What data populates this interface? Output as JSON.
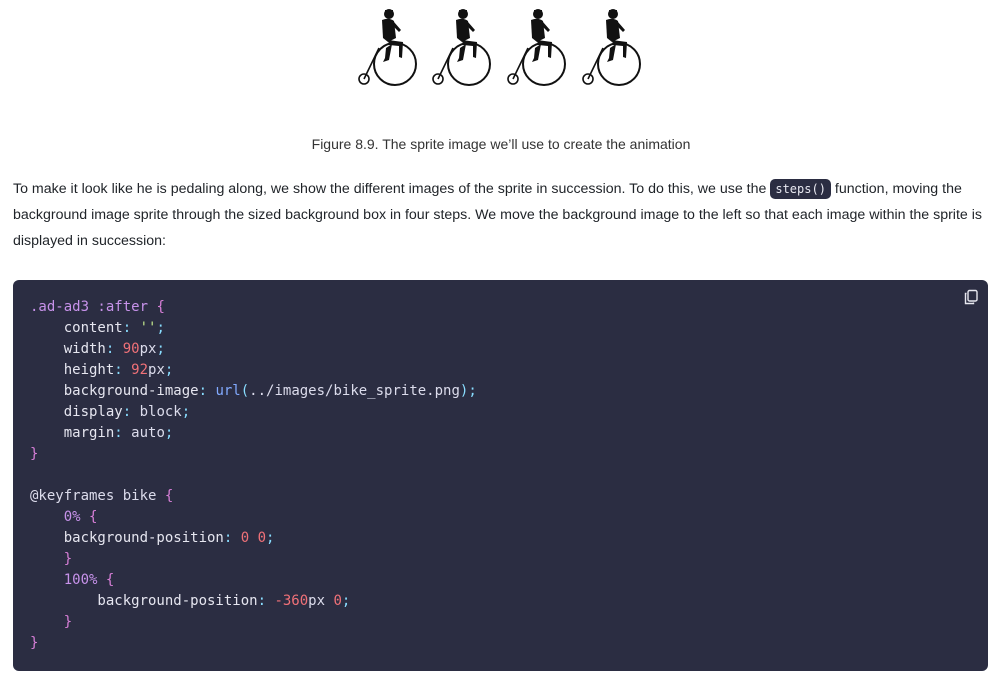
{
  "figure": {
    "caption": "Figure 8.9. The sprite image we’ll use to create the animation",
    "image_description_icon": "penny-farthing-rider-sprite"
  },
  "paragraph": {
    "before": "To make it look like he is pedaling along, we show the different images of the sprite in succession. To do this, we use the ",
    "code": "steps()",
    "after": " function, moving the background image sprite through the sized background box in four steps. We move the background image to the left so that each image within the sprite is displayed in succession:"
  },
  "code_block": {
    "copy_icon": "copy-icon",
    "lines": [
      [
        {
          "t": ".ad-ad3 :after ",
          "c": "k"
        },
        {
          "t": "{",
          "c": "br"
        }
      ],
      [
        {
          "t": "    content",
          "c": "p"
        },
        {
          "t": ":",
          "c": "o"
        },
        {
          "t": " ''",
          "c": "s"
        },
        {
          "t": ";",
          "c": "o"
        }
      ],
      [
        {
          "t": "    width",
          "c": "p"
        },
        {
          "t": ":",
          "c": "o"
        },
        {
          "t": " 90",
          "c": "v"
        },
        {
          "t": "px",
          "c": "u"
        },
        {
          "t": ";",
          "c": "o"
        }
      ],
      [
        {
          "t": "    height",
          "c": "p"
        },
        {
          "t": ":",
          "c": "o"
        },
        {
          "t": " 92",
          "c": "v"
        },
        {
          "t": "px",
          "c": "u"
        },
        {
          "t": ";",
          "c": "o"
        }
      ],
      [
        {
          "t": "    background-image",
          "c": "p"
        },
        {
          "t": ":",
          "c": "o"
        },
        {
          "t": " url",
          "c": "f"
        },
        {
          "t": "(",
          "c": "o"
        },
        {
          "t": "../images/bike_sprite.png",
          "c": "u"
        },
        {
          "t": ")",
          "c": "o"
        },
        {
          "t": ";",
          "c": "o"
        }
      ],
      [
        {
          "t": "    display",
          "c": "p"
        },
        {
          "t": ":",
          "c": "o"
        },
        {
          "t": " block",
          "c": "u"
        },
        {
          "t": ";",
          "c": "o"
        }
      ],
      [
        {
          "t": "    margin",
          "c": "p"
        },
        {
          "t": ":",
          "c": "o"
        },
        {
          "t": " auto",
          "c": "u"
        },
        {
          "t": ";",
          "c": "o"
        }
      ],
      [
        {
          "t": "}",
          "c": "br"
        }
      ],
      [],
      [
        {
          "t": "@keyframes bike ",
          "c": "u"
        },
        {
          "t": "{",
          "c": "br"
        }
      ],
      [
        {
          "t": "    0% ",
          "c": "k"
        },
        {
          "t": "{",
          "c": "br"
        }
      ],
      [
        {
          "t": "    background-position",
          "c": "p"
        },
        {
          "t": ":",
          "c": "o"
        },
        {
          "t": " 0 0",
          "c": "v"
        },
        {
          "t": ";",
          "c": "o"
        }
      ],
      [
        {
          "t": "    }",
          "c": "br"
        }
      ],
      [
        {
          "t": "    100% ",
          "c": "k"
        },
        {
          "t": "{",
          "c": "br"
        }
      ],
      [
        {
          "t": "        background-position",
          "c": "p"
        },
        {
          "t": ":",
          "c": "o"
        },
        {
          "t": " -360",
          "c": "v"
        },
        {
          "t": "px",
          "c": "u"
        },
        {
          "t": " 0",
          "c": "v"
        },
        {
          "t": ";",
          "c": "o"
        }
      ],
      [
        {
          "t": "    }",
          "c": "br"
        }
      ],
      [
        {
          "t": "}",
          "c": "br"
        }
      ]
    ]
  }
}
